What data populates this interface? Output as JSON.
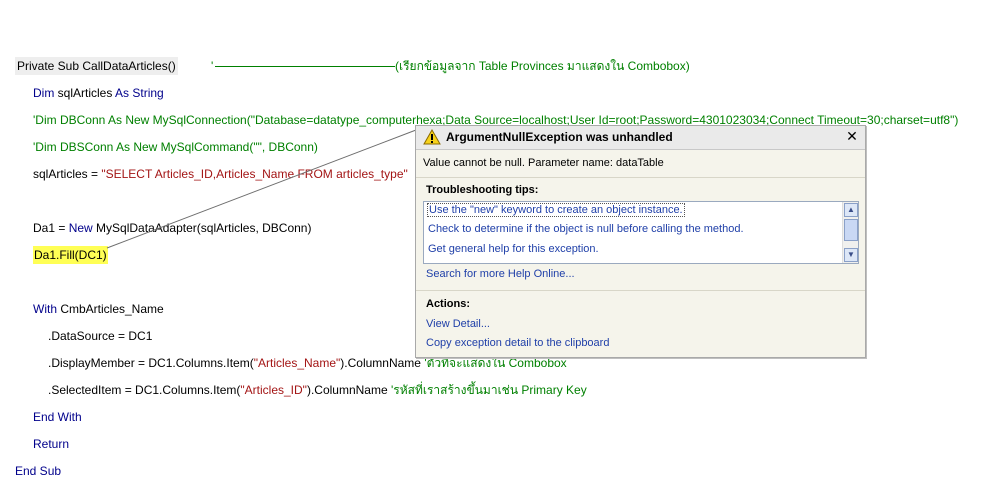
{
  "code": {
    "sub_decl": "Private Sub CallDataArticles()",
    "sub_comment_tick": "'",
    "sub_comment_text": "(เรียกข้อมูลจาก Table Provinces มาแสดงใน Combobox)",
    "dim_kw": "Dim",
    "dim_name": " sqlArticles ",
    "as_kw": "As",
    "string_kw": " String",
    "comment_dbconn": "'Dim DBConn As New MySqlConnection(\"Database=datatype_computerhexa;Data Source=localhost;User Id=root;Password=4301023034;Connect Timeout=30;charset=utf8\")",
    "comment_dbsconn": "'Dim DBSConn As New MySqlCommand(\"\", DBConn)",
    "sql_assign": "sqlArticles = ",
    "sql_string": "\"SELECT Articles_ID,Articles_Name FROM articles_type\"",
    "da_assign": "Da1 = ",
    "new_kw": "New",
    "da_rest": " MySqlDataAdapter(sqlArticles, DBConn)",
    "fill_line": "Da1.Fill(DC1)",
    "with_kw": "With",
    "with_rest": " CmbArticles_Name",
    "datasource_line": ".DataSource = DC1",
    "display_pre": ".DisplayMember = DC1.Columns.Item(",
    "display_str": "\"Articles_Name\"",
    "display_post": ").ColumnName  ",
    "display_comment": "'ตัวที่จะแสดงใน Combobox",
    "selected_pre": ".SelectedItem = DC1.Columns.Item(",
    "selected_str": "\"Articles_ID\"",
    "selected_post": ").ColumnName ",
    "selected_comment": "'รหัสที่เราสร้างขึ้นมาเช่น Primary Key",
    "end_with": "End With",
    "return_kw": "Return",
    "end_sub": "End Sub"
  },
  "exception": {
    "title": "ArgumentNullException was unhandled",
    "message": "Value cannot be null. Parameter name: dataTable",
    "tips_heading": "Troubleshooting tips:",
    "tips": [
      "Use the \"new\" keyword to create an object instance.",
      "Check to determine if the object is null before calling the method.",
      "Get general help for this exception."
    ],
    "search_link": "Search for more Help Online...",
    "actions_heading": "Actions:",
    "actions": [
      "View Detail...",
      "Copy exception detail to the clipboard"
    ]
  },
  "colors": {
    "keyword": "#00008b",
    "comment": "#008000",
    "string": "#a31515",
    "highlight_current": "#ffff55",
    "link": "#1f3fa8"
  },
  "icons": [
    "warning-icon",
    "close-icon",
    "scroll-up-icon",
    "scroll-down-icon"
  ]
}
